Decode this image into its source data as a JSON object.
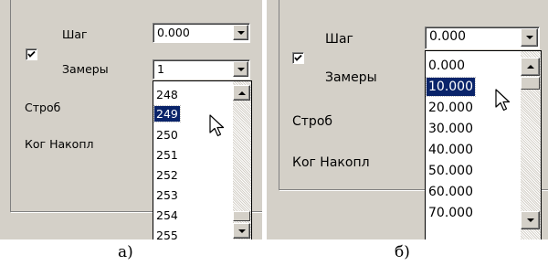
{
  "panel_a": {
    "step_label": "Шаг",
    "step_value": "0.000",
    "measurements_label": "Замеры",
    "measurements_value": "1",
    "strobe_label": "Строб",
    "accum_label": "Ког Накопл",
    "dropdown_items": [
      "248",
      "249",
      "250",
      "251",
      "252",
      "253",
      "254",
      "255"
    ],
    "selected_item": "249",
    "checkbox_checked": true,
    "caption": "а)"
  },
  "panel_b": {
    "step_label": "Шаг",
    "step_value": "0.000",
    "measurements_label": "Замеры",
    "strobe_label": "Строб",
    "accum_label": "Ког Накопл",
    "dropdown_items": [
      "0.000",
      "10.000",
      "20.000",
      "30.000",
      "40.000",
      "50.000",
      "60.000",
      "70.000"
    ],
    "selected_item": "10.000",
    "checkbox_checked": true,
    "caption": "б)"
  },
  "colors": {
    "window_bg": "#d4d0c8",
    "selection_bg": "#0a246a",
    "selection_text": "#ffffff"
  },
  "icons": [
    "check-icon",
    "dropdown-arrow-icon",
    "scroll-up-icon",
    "scroll-down-icon",
    "mouse-pointer-icon"
  ]
}
